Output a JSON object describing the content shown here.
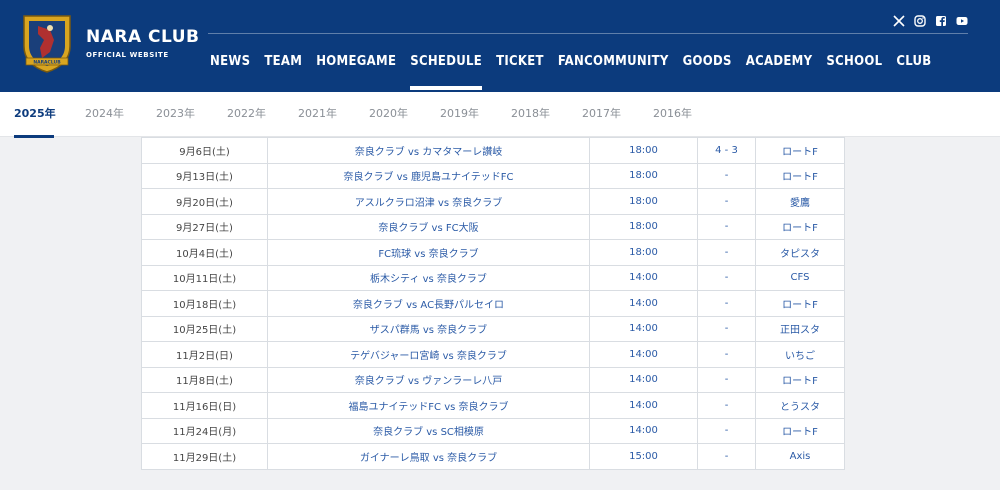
{
  "site": {
    "title": "NARA CLUB",
    "subtitle": "OFFICIAL WEBSITE",
    "logo_text": "NARACLUB"
  },
  "colors": {
    "primary": "#0c3b7d",
    "link": "#2a5aa6",
    "gold": "#d9a520"
  },
  "social": [
    {
      "name": "x-icon"
    },
    {
      "name": "instagram-icon"
    },
    {
      "name": "facebook-icon"
    },
    {
      "name": "youtube-icon"
    }
  ],
  "nav": {
    "items": [
      {
        "label": "NEWS"
      },
      {
        "label": "TEAM"
      },
      {
        "label": "HOMEGAME"
      },
      {
        "label": "SCHEDULE",
        "active": true
      },
      {
        "label": "TICKET"
      },
      {
        "label": "FANCOMMUNITY"
      },
      {
        "label": "GOODS"
      },
      {
        "label": "ACADEMY"
      },
      {
        "label": "SCHOOL"
      },
      {
        "label": "CLUB"
      }
    ]
  },
  "years": {
    "items": [
      "2025年",
      "2024年",
      "2023年",
      "2022年",
      "2021年",
      "2020年",
      "2019年",
      "2018年",
      "2017年",
      "2016年"
    ],
    "active": "2025年"
  },
  "schedule": {
    "rows": [
      {
        "date": "9月6日(土)",
        "match": "奈良クラブ vs カマタマーレ讃岐",
        "time": "18:00",
        "score": "4 - 3",
        "venue": "ロートF"
      },
      {
        "date": "9月13日(土)",
        "match": "奈良クラブ vs 鹿児島ユナイテッドFC",
        "time": "18:00",
        "score": "-",
        "venue": "ロートF"
      },
      {
        "date": "9月20日(土)",
        "match": "アスルクラロ沼津 vs 奈良クラブ",
        "time": "18:00",
        "score": "-",
        "venue": "愛鷹"
      },
      {
        "date": "9月27日(土)",
        "match": "奈良クラブ vs FC大阪",
        "time": "18:00",
        "score": "-",
        "venue": "ロートF"
      },
      {
        "date": "10月4日(土)",
        "match": "FC琉球 vs 奈良クラブ",
        "time": "18:00",
        "score": "-",
        "venue": "タピスタ"
      },
      {
        "date": "10月11日(土)",
        "match": "栃木シティ vs 奈良クラブ",
        "time": "14:00",
        "score": "-",
        "venue": "CFS"
      },
      {
        "date": "10月18日(土)",
        "match": "奈良クラブ vs AC長野パルセイロ",
        "time": "14:00",
        "score": "-",
        "venue": "ロートF"
      },
      {
        "date": "10月25日(土)",
        "match": "ザスパ群馬 vs 奈良クラブ",
        "time": "14:00",
        "score": "-",
        "venue": "正田スタ"
      },
      {
        "date": "11月2日(日)",
        "match": "テゲバジャーロ宮崎 vs 奈良クラブ",
        "time": "14:00",
        "score": "-",
        "venue": "いちご"
      },
      {
        "date": "11月8日(土)",
        "match": "奈良クラブ vs ヴァンラーレ八戸",
        "time": "14:00",
        "score": "-",
        "venue": "ロートF"
      },
      {
        "date": "11月16日(日)",
        "match": "福島ユナイテッドFC vs 奈良クラブ",
        "time": "14:00",
        "score": "-",
        "venue": "とうスタ"
      },
      {
        "date": "11月24日(月)",
        "match": "奈良クラブ vs SC相模原",
        "time": "14:00",
        "score": "-",
        "venue": "ロートF"
      },
      {
        "date": "11月29日(土)",
        "match": "ガイナーレ鳥取 vs 奈良クラブ",
        "time": "15:00",
        "score": "-",
        "venue": "Axis"
      }
    ]
  }
}
